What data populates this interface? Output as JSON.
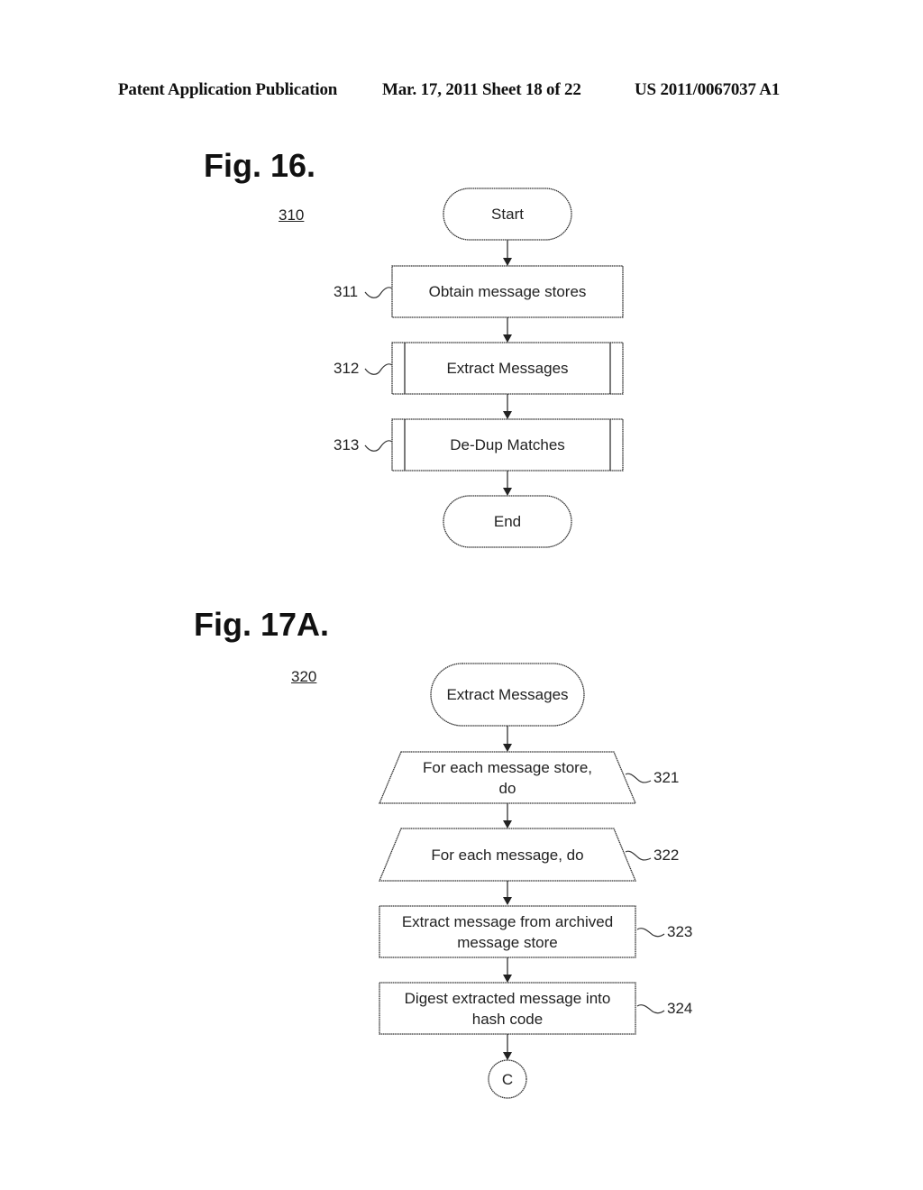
{
  "header": {
    "publication": "Patent Application Publication",
    "date_sheet": "Mar. 17, 2011  Sheet 18 of 22",
    "number": "US 2011/0067037 A1"
  },
  "fig16": {
    "title": "Fig. 16.",
    "ref": "310",
    "nodes": [
      {
        "id": "start",
        "type": "terminal",
        "label": "Start"
      },
      {
        "id": "311",
        "type": "process",
        "label": "Obtain message stores",
        "ref": "311"
      },
      {
        "id": "312",
        "type": "subprocess",
        "label": "Extract Messages",
        "ref": "312"
      },
      {
        "id": "313",
        "type": "subprocess",
        "label": "De-Dup Matches",
        "ref": "313"
      },
      {
        "id": "end",
        "type": "terminal",
        "label": "End"
      }
    ]
  },
  "fig17a": {
    "title": "Fig. 17A.",
    "ref": "320",
    "nodes": [
      {
        "id": "extract",
        "type": "terminal",
        "label": "Extract Messages"
      },
      {
        "id": "321",
        "type": "loop",
        "label_lines": [
          "For each message store,",
          "do"
        ],
        "ref": "321"
      },
      {
        "id": "322",
        "type": "loop",
        "label_lines": [
          "For each message, do"
        ],
        "ref": "322"
      },
      {
        "id": "323",
        "type": "process",
        "label_lines": [
          "Extract message from archived",
          "message store"
        ],
        "ref": "323"
      },
      {
        "id": "324",
        "type": "process",
        "label_lines": [
          "Digest extracted message into",
          "hash code"
        ],
        "ref": "324"
      },
      {
        "id": "c",
        "type": "connector",
        "label": "C"
      }
    ]
  }
}
